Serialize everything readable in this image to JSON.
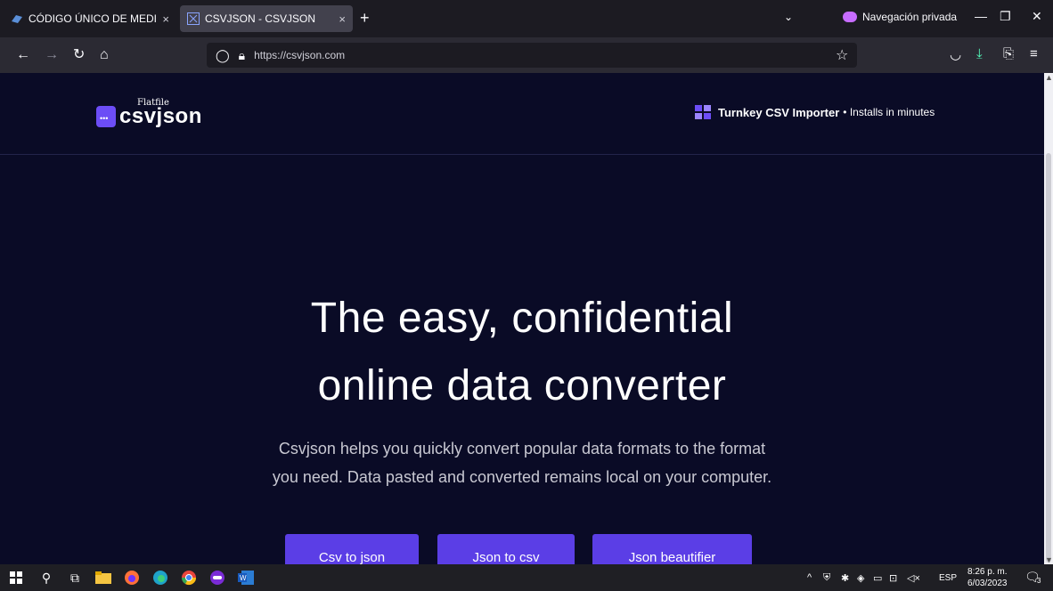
{
  "browser": {
    "tabs": [
      {
        "title": "CÓDIGO ÚNICO DE MEDICAMENTOS",
        "close": "×"
      },
      {
        "title": "CSVJSON - CSVJSON",
        "close": "×"
      }
    ],
    "new_tab": "+",
    "private_label": "Navegación privada",
    "url": "https://csvjson.com"
  },
  "page": {
    "logo_small": "Flatfile",
    "logo_main": "csvjson",
    "turnkey_bold": "Turnkey CSV Importer",
    "turnkey_rest": "• Installs in minutes",
    "headline_1": "The easy, confidential",
    "headline_2": "online data converter",
    "sub_1": "Csvjson helps you quickly convert popular data formats to the format",
    "sub_2": "you need. Data pasted and converted remains local on your computer.",
    "buttons": [
      "Csv to json",
      "Json to csv",
      "Json beautifier"
    ]
  },
  "taskbar": {
    "lang": "ESP",
    "time": "8:26 p. m.",
    "date": "6/03/2023",
    "notif_count": "3"
  },
  "colors": {
    "page_bg": "#0a0b26",
    "accent": "#5b3ee6"
  }
}
